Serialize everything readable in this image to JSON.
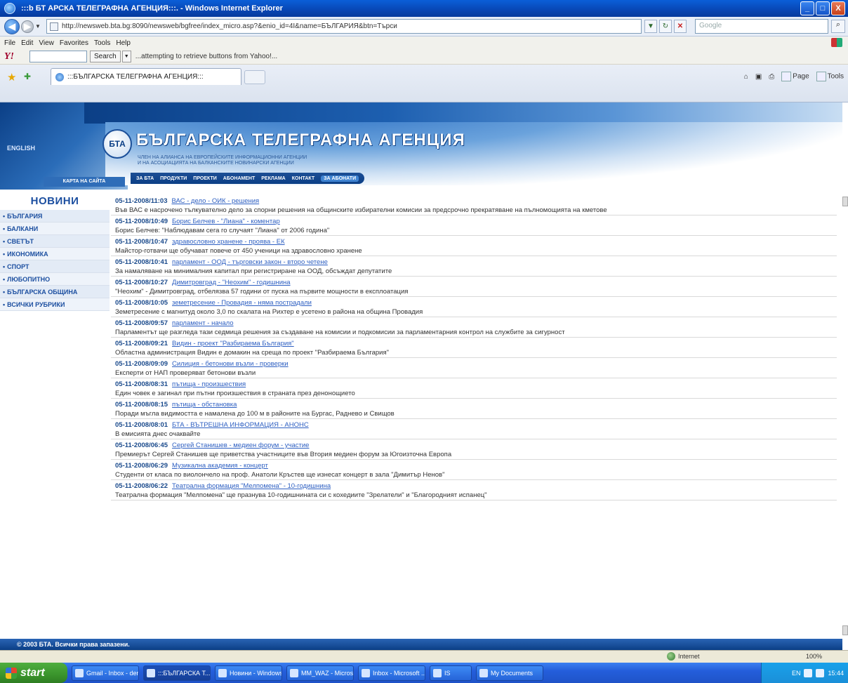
{
  "window": {
    "title": ":::b БТ АРСКА ТЕЛЕГРАФНА АГЕНЦИЯ:::. - Windows Internet Explorer",
    "minimize": "_",
    "maximize": "□",
    "close": "X"
  },
  "browser": {
    "address": "http://newsweb.bta.bg:8090/newsweb/bgfree/index_micro.asp?&enio_id=4I&name=БЪЛГАРИЯ&btn=Търси",
    "search_placeholder": "Google",
    "menu": [
      "File",
      "Edit",
      "View",
      "Favorites",
      "Tools",
      "Help"
    ],
    "yahoo_search_label": "Search",
    "yahoo_status": "...attempting to retrieve buttons from Yahoo!...",
    "tab_title": ":::БЪЛГАРСКА ТЕЛЕГРАФНА АГЕНЦИЯ:::",
    "command_bar": [
      "Page",
      "Tools"
    ]
  },
  "banner": {
    "english": "ENGLISH",
    "logo_text": "БТА",
    "title": "БЪЛГАРСКА ТЕЛЕГРАФНА АГЕНЦИЯ",
    "subtitle1": "ЧЛЕН НА АЛИАНСА НА ЕВРОПЕЙСКИТЕ ИНФОРМАЦИОННИ АГЕНЦИИ",
    "subtitle2": "И НА АСОЦИАЦИЯТА НА БАЛКАНСКИТЕ НОВИНАРСКИ АГЕНЦИИ",
    "nav": [
      "ЗА БТА",
      "ПРОДУКТИ",
      "ПРОЕКТИ",
      "АБОНАМЕНТ",
      "РЕКЛАМА",
      "КОНТАКТ"
    ],
    "subscribers": "ЗА АБОНАТИ",
    "sitemap": "КАРТА НА САЙТА"
  },
  "sidebar": {
    "title": "НОВИНИ",
    "items": [
      "БЪЛГАРИЯ",
      "БАЛКАНИ",
      "СВЕТЪТ",
      "ИКОНОМИКА",
      "СПОРТ",
      "ЛЮБОПИТНО",
      "БЪЛГАРСКА ОБЩИНА",
      "ВСИЧКИ РУБРИКИ"
    ]
  },
  "news": [
    {
      "date": "05-11-2008/11:03",
      "title": "ВАС - дело - ОИК - решения",
      "summary": "Във ВАС е насрочено тълкувателно дело за спорни решения на общинските избирателни комисии за предсрочно прекратяване на пълномощията на кметове"
    },
    {
      "date": "05-11-2008/10:49",
      "title": "Борис Белчев - \"Лиана\" - коментар",
      "summary": "Борис Белчев: \"Наблюдавам сега го случаят \"Лиана\" от 2006 година\""
    },
    {
      "date": "05-11-2008/10:47",
      "title": "здравословно хранене - проява - ЕК",
      "summary": "Майстор-готвачи ще обучават повече от 450 ученици на здравословно хранене"
    },
    {
      "date": "05-11-2008/10:41",
      "title": "парламент - ООД - търговски закон - второ четене",
      "summary": "За намаляване на минималния капитал при регистриране на ООД, обсъждат депутатите"
    },
    {
      "date": "05-11-2008/10:27",
      "title": "Димитровград - \"Неохим\" - годишнина",
      "summary": "\"Неохим\" - Димитровград, отбелязва 57 години от пуска на първите мощности в експлоатация"
    },
    {
      "date": "05-11-2008/10:05",
      "title": "земетресение - Провадия - няма пострадали",
      "summary": "Земетресение с магнитуд около 3,0 по скалата на Рихтер е усетено в района на община Провадия"
    },
    {
      "date": "05-11-2008/09:57",
      "title": "парламент - начало",
      "summary": "Парламентът ще разгледа тази седмица решения за създаване на комисии и подкомисии за парламентарния контрол на службите за сигурност"
    },
    {
      "date": "05-11-2008/09:21",
      "title": "Видин - проект \"Разбираема България\"",
      "summary": "Областна администрация Видин е домакин на среща по проект \"Разбираема България\""
    },
    {
      "date": "05-11-2008/09:09",
      "title": "Силиция - бетонови възли - проверки",
      "summary": "Експерти от НАП проверяват бетонови възли"
    },
    {
      "date": "05-11-2008/08:31",
      "title": "пътища - произшествия",
      "summary": "Един човек е загинал при пътни произшествия в страната през денонощието"
    },
    {
      "date": "05-11-2008/08:15",
      "title": "пътища - обстановка",
      "summary": "Поради мъгла видимостта е намалена до 100 м в районите на Бургас, Раднево и Свищов"
    },
    {
      "date": "05-11-2008/08:01",
      "title": "БТА - ВЪТРЕШНА ИНФОРМАЦИЯ - АНОНС",
      "summary": "В емисията днес очаквайте"
    },
    {
      "date": "05-11-2008/06:45",
      "title": "Сергей Станишев - медиен форум - участие",
      "summary": "Премиерът Сергей Станишев ще приветства участниците във Втория медиен форум за Югоизточна Европа"
    },
    {
      "date": "05-11-2008/06:29",
      "title": "Музикална академия - концерт",
      "summary": "Студенти от класа по виолончело на проф. Анатоли Кръстев ще изнесат концерт в зала \"Димитър Ненов\""
    },
    {
      "date": "05-11-2008/06:22",
      "title": "Театрална формация \"Мелпомена\" - 10-годишнина",
      "summary": "Театрална формация \"Мелпомена\" ще празнува 10-годишнината си с кохедиите \"Зрелатели\" и \"Благородният испанец\""
    }
  ],
  "footer": "© 2003 БТА. Всички права запазени.",
  "status": {
    "zone": "Internet",
    "zoom": "100%"
  },
  "taskbar": {
    "start": "start",
    "tasks": [
      "Gmail - Inbox - den...",
      ":::БЪЛГАРСКА Т...",
      "Новини - Windows...",
      "MM_WAZ - Microso...",
      "Inbox - Microsoft ...",
      "IS",
      "My Documents"
    ],
    "clock": "15:44",
    "lang": "EN"
  }
}
